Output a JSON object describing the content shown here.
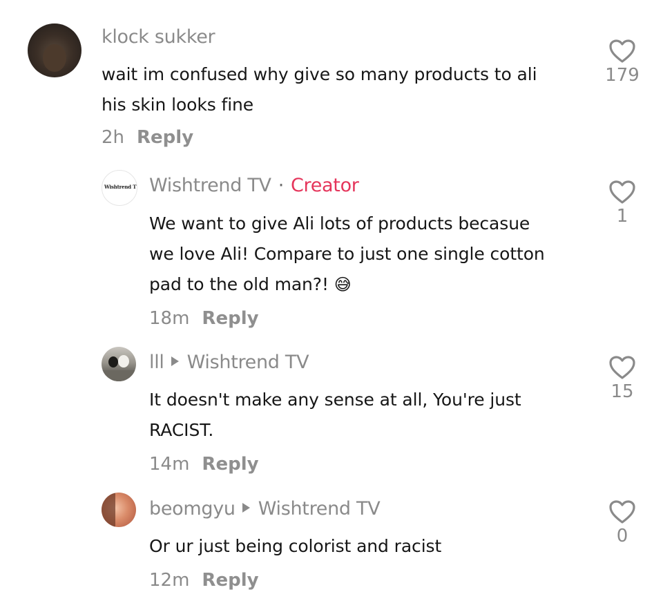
{
  "comments": [
    {
      "username": "klock sukker",
      "text_lines": [
        "wait im confused why give so many products to ali",
        "his skin looks fine"
      ],
      "time": "2h",
      "reply_label": "Reply",
      "likes": "179"
    },
    {
      "username": "Wishtrend TV",
      "separator": "·",
      "badge": "Creator",
      "avatar_logo": "Wishtrend TV",
      "text_lines": [
        "We want to give Ali lots of products becasue",
        "we love Ali! Compare to just one single cotton",
        "pad to the old man?!"
      ],
      "emoji": "😅",
      "time": "18m",
      "reply_label": "Reply",
      "likes": "1"
    },
    {
      "username": "lll",
      "reply_to": "Wishtrend TV",
      "text_lines": [
        "It doesn't make any sense at all, You're just",
        "RACIST."
      ],
      "time": "14m",
      "reply_label": "Reply",
      "likes": "15"
    },
    {
      "username": "beomgyu",
      "reply_to": "Wishtrend TV",
      "text_lines": [
        "Or ur just being colorist and racist"
      ],
      "time": "12m",
      "reply_label": "Reply",
      "likes": "0"
    }
  ],
  "icons": {
    "like": "heart-outline-icon",
    "reply_arrow": "play-arrow-icon"
  },
  "colors": {
    "creator_badge": "#e5355b",
    "muted": "#8a8a8a",
    "text": "#161616"
  }
}
